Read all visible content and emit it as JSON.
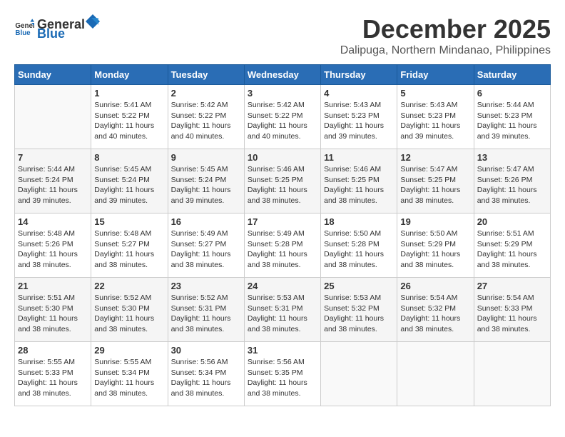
{
  "header": {
    "logo_general": "General",
    "logo_blue": "Blue",
    "month_title": "December 2025",
    "location": "Dalipuga, Northern Mindanao, Philippines"
  },
  "days_of_week": [
    "Sunday",
    "Monday",
    "Tuesday",
    "Wednesday",
    "Thursday",
    "Friday",
    "Saturday"
  ],
  "weeks": [
    [
      {
        "day": "",
        "sunrise": "",
        "sunset": "",
        "daylight": ""
      },
      {
        "day": "1",
        "sunrise": "Sunrise: 5:41 AM",
        "sunset": "Sunset: 5:22 PM",
        "daylight": "Daylight: 11 hours and 40 minutes."
      },
      {
        "day": "2",
        "sunrise": "Sunrise: 5:42 AM",
        "sunset": "Sunset: 5:22 PM",
        "daylight": "Daylight: 11 hours and 40 minutes."
      },
      {
        "day": "3",
        "sunrise": "Sunrise: 5:42 AM",
        "sunset": "Sunset: 5:22 PM",
        "daylight": "Daylight: 11 hours and 40 minutes."
      },
      {
        "day": "4",
        "sunrise": "Sunrise: 5:43 AM",
        "sunset": "Sunset: 5:23 PM",
        "daylight": "Daylight: 11 hours and 39 minutes."
      },
      {
        "day": "5",
        "sunrise": "Sunrise: 5:43 AM",
        "sunset": "Sunset: 5:23 PM",
        "daylight": "Daylight: 11 hours and 39 minutes."
      },
      {
        "day": "6",
        "sunrise": "Sunrise: 5:44 AM",
        "sunset": "Sunset: 5:23 PM",
        "daylight": "Daylight: 11 hours and 39 minutes."
      }
    ],
    [
      {
        "day": "7",
        "sunrise": "Sunrise: 5:44 AM",
        "sunset": "Sunset: 5:24 PM",
        "daylight": "Daylight: 11 hours and 39 minutes."
      },
      {
        "day": "8",
        "sunrise": "Sunrise: 5:45 AM",
        "sunset": "Sunset: 5:24 PM",
        "daylight": "Daylight: 11 hours and 39 minutes."
      },
      {
        "day": "9",
        "sunrise": "Sunrise: 5:45 AM",
        "sunset": "Sunset: 5:24 PM",
        "daylight": "Daylight: 11 hours and 39 minutes."
      },
      {
        "day": "10",
        "sunrise": "Sunrise: 5:46 AM",
        "sunset": "Sunset: 5:25 PM",
        "daylight": "Daylight: 11 hours and 38 minutes."
      },
      {
        "day": "11",
        "sunrise": "Sunrise: 5:46 AM",
        "sunset": "Sunset: 5:25 PM",
        "daylight": "Daylight: 11 hours and 38 minutes."
      },
      {
        "day": "12",
        "sunrise": "Sunrise: 5:47 AM",
        "sunset": "Sunset: 5:25 PM",
        "daylight": "Daylight: 11 hours and 38 minutes."
      },
      {
        "day": "13",
        "sunrise": "Sunrise: 5:47 AM",
        "sunset": "Sunset: 5:26 PM",
        "daylight": "Daylight: 11 hours and 38 minutes."
      }
    ],
    [
      {
        "day": "14",
        "sunrise": "Sunrise: 5:48 AM",
        "sunset": "Sunset: 5:26 PM",
        "daylight": "Daylight: 11 hours and 38 minutes."
      },
      {
        "day": "15",
        "sunrise": "Sunrise: 5:48 AM",
        "sunset": "Sunset: 5:27 PM",
        "daylight": "Daylight: 11 hours and 38 minutes."
      },
      {
        "day": "16",
        "sunrise": "Sunrise: 5:49 AM",
        "sunset": "Sunset: 5:27 PM",
        "daylight": "Daylight: 11 hours and 38 minutes."
      },
      {
        "day": "17",
        "sunrise": "Sunrise: 5:49 AM",
        "sunset": "Sunset: 5:28 PM",
        "daylight": "Daylight: 11 hours and 38 minutes."
      },
      {
        "day": "18",
        "sunrise": "Sunrise: 5:50 AM",
        "sunset": "Sunset: 5:28 PM",
        "daylight": "Daylight: 11 hours and 38 minutes."
      },
      {
        "day": "19",
        "sunrise": "Sunrise: 5:50 AM",
        "sunset": "Sunset: 5:29 PM",
        "daylight": "Daylight: 11 hours and 38 minutes."
      },
      {
        "day": "20",
        "sunrise": "Sunrise: 5:51 AM",
        "sunset": "Sunset: 5:29 PM",
        "daylight": "Daylight: 11 hours and 38 minutes."
      }
    ],
    [
      {
        "day": "21",
        "sunrise": "Sunrise: 5:51 AM",
        "sunset": "Sunset: 5:30 PM",
        "daylight": "Daylight: 11 hours and 38 minutes."
      },
      {
        "day": "22",
        "sunrise": "Sunrise: 5:52 AM",
        "sunset": "Sunset: 5:30 PM",
        "daylight": "Daylight: 11 hours and 38 minutes."
      },
      {
        "day": "23",
        "sunrise": "Sunrise: 5:52 AM",
        "sunset": "Sunset: 5:31 PM",
        "daylight": "Daylight: 11 hours and 38 minutes."
      },
      {
        "day": "24",
        "sunrise": "Sunrise: 5:53 AM",
        "sunset": "Sunset: 5:31 PM",
        "daylight": "Daylight: 11 hours and 38 minutes."
      },
      {
        "day": "25",
        "sunrise": "Sunrise: 5:53 AM",
        "sunset": "Sunset: 5:32 PM",
        "daylight": "Daylight: 11 hours and 38 minutes."
      },
      {
        "day": "26",
        "sunrise": "Sunrise: 5:54 AM",
        "sunset": "Sunset: 5:32 PM",
        "daylight": "Daylight: 11 hours and 38 minutes."
      },
      {
        "day": "27",
        "sunrise": "Sunrise: 5:54 AM",
        "sunset": "Sunset: 5:33 PM",
        "daylight": "Daylight: 11 hours and 38 minutes."
      }
    ],
    [
      {
        "day": "28",
        "sunrise": "Sunrise: 5:55 AM",
        "sunset": "Sunset: 5:33 PM",
        "daylight": "Daylight: 11 hours and 38 minutes."
      },
      {
        "day": "29",
        "sunrise": "Sunrise: 5:55 AM",
        "sunset": "Sunset: 5:34 PM",
        "daylight": "Daylight: 11 hours and 38 minutes."
      },
      {
        "day": "30",
        "sunrise": "Sunrise: 5:56 AM",
        "sunset": "Sunset: 5:34 PM",
        "daylight": "Daylight: 11 hours and 38 minutes."
      },
      {
        "day": "31",
        "sunrise": "Sunrise: 5:56 AM",
        "sunset": "Sunset: 5:35 PM",
        "daylight": "Daylight: 11 hours and 38 minutes."
      },
      {
        "day": "",
        "sunrise": "",
        "sunset": "",
        "daylight": ""
      },
      {
        "day": "",
        "sunrise": "",
        "sunset": "",
        "daylight": ""
      },
      {
        "day": "",
        "sunrise": "",
        "sunset": "",
        "daylight": ""
      }
    ]
  ]
}
